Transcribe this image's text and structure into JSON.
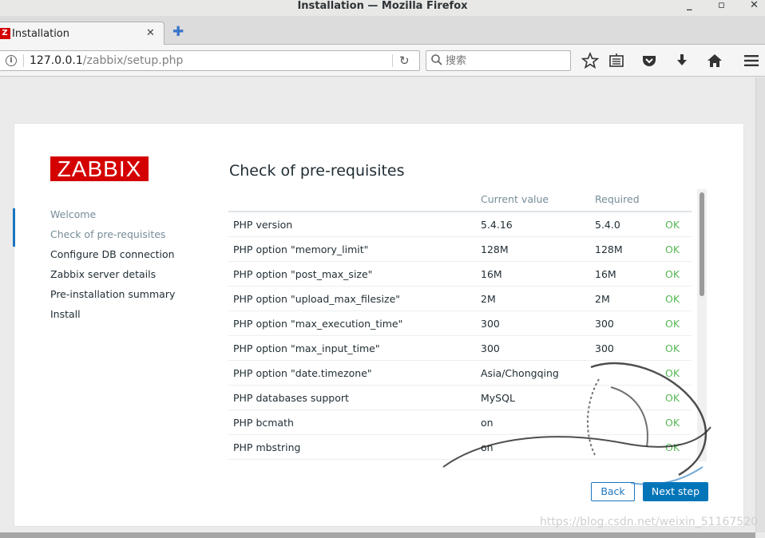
{
  "window": {
    "title": "Installation — Mozilla Firefox"
  },
  "tabs": [
    {
      "label": "Installation",
      "favicon": "Z"
    }
  ],
  "nav": {
    "url_host": "127.0.0.1",
    "url_path": "/zabbix/setup.php",
    "search_placeholder": "搜索"
  },
  "sidebar": {
    "logo": "ZABBIX",
    "steps": [
      {
        "label": "Welcome",
        "state": "done"
      },
      {
        "label": "Check of pre-requisites",
        "state": "current"
      },
      {
        "label": "Configure DB connection",
        "state": "pending"
      },
      {
        "label": "Zabbix server details",
        "state": "pending"
      },
      {
        "label": "Pre-installation summary",
        "state": "pending"
      },
      {
        "label": "Install",
        "state": "pending"
      }
    ]
  },
  "main": {
    "heading": "Check of pre-requisites",
    "columns": {
      "current": "Current value",
      "required": "Required"
    },
    "rows": [
      {
        "name": "PHP version",
        "current": "5.4.16",
        "required": "5.4.0",
        "status": "OK"
      },
      {
        "name": "PHP option \"memory_limit\"",
        "current": "128M",
        "required": "128M",
        "status": "OK"
      },
      {
        "name": "PHP option \"post_max_size\"",
        "current": "16M",
        "required": "16M",
        "status": "OK"
      },
      {
        "name": "PHP option \"upload_max_filesize\"",
        "current": "2M",
        "required": "2M",
        "status": "OK"
      },
      {
        "name": "PHP option \"max_execution_time\"",
        "current": "300",
        "required": "300",
        "status": "OK"
      },
      {
        "name": "PHP option \"max_input_time\"",
        "current": "300",
        "required": "300",
        "status": "OK"
      },
      {
        "name": "PHP option \"date.timezone\"",
        "current": "Asia/Chongqing",
        "required": "",
        "status": "OK"
      },
      {
        "name": "PHP databases support",
        "current": "MySQL",
        "required": "",
        "status": "OK"
      },
      {
        "name": "PHP bcmath",
        "current": "on",
        "required": "",
        "status": "OK"
      },
      {
        "name": "PHP mbstring",
        "current": "on",
        "required": "",
        "status": "OK"
      }
    ],
    "back_label": "Back",
    "next_label": "Next step"
  },
  "watermark": "https://blog.csdn.net/weixin_51167520",
  "colors": {
    "brand_red": "#d40000",
    "accent_blue": "#0275b8",
    "ok_green": "#56b956",
    "muted": "#768d99"
  }
}
